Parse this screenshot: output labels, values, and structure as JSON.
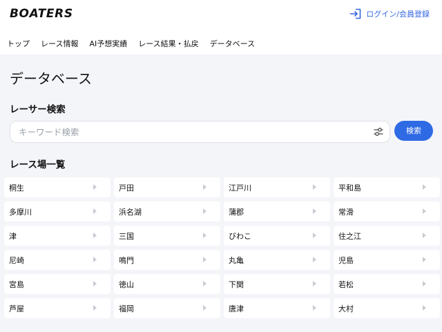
{
  "header": {
    "logo": "BOATERS",
    "login_label": "ログイン/会員登録"
  },
  "nav": {
    "items": [
      "トップ",
      "レース情報",
      "AI予想実績",
      "レース結果・払戻",
      "データベース"
    ]
  },
  "main": {
    "page_title": "データベース",
    "search_section_title": "レーサー検索",
    "search_placeholder": "キーワード検索",
    "search_button": "検索",
    "list_section_title": "レース場一覧"
  },
  "venues": [
    "桐生",
    "戸田",
    "江戸川",
    "平和島",
    "多摩川",
    "浜名湖",
    "蒲郡",
    "常滑",
    "津",
    "三国",
    "びわこ",
    "住之江",
    "尼崎",
    "鳴門",
    "丸亀",
    "児島",
    "宮島",
    "徳山",
    "下関",
    "若松",
    "芦屋",
    "福岡",
    "唐津",
    "大村"
  ],
  "colors": {
    "accent": "#2f6ae5",
    "link": "#3366e0",
    "background": "#f4f5f9"
  },
  "icons": {
    "login": "login-arrow-icon",
    "filter": "sliders-icon",
    "venue_arrow": "triangle-right-icon"
  }
}
